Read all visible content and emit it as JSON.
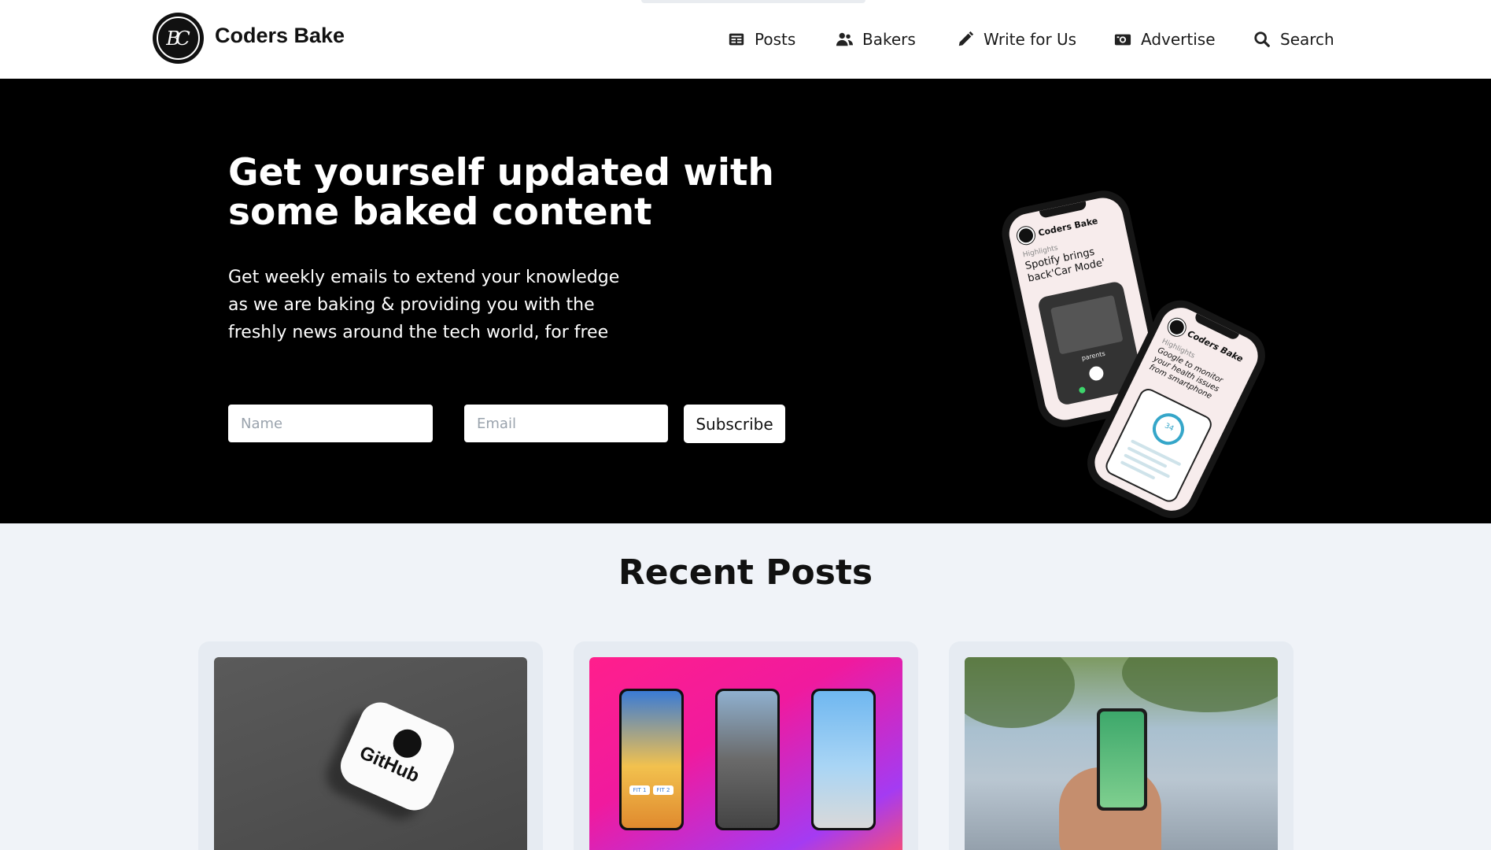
{
  "header": {
    "brand": "Coders Bake",
    "logo_glyph": "BC",
    "nav": [
      {
        "label": "Posts",
        "icon": "newspaper-icon"
      },
      {
        "label": "Bakers",
        "icon": "users-icon"
      },
      {
        "label": "Write for Us",
        "icon": "pencil-icon"
      },
      {
        "label": "Advertise",
        "icon": "ad-icon"
      },
      {
        "label": "Search",
        "icon": "search-icon"
      }
    ]
  },
  "hero": {
    "title": "Get yourself updated with some baked content",
    "text": "Get weekly emails to extend your knowledge as we are baking & providing you with the freshly news around the tech world, for free",
    "name_placeholder": "Name",
    "email_placeholder": "Email",
    "subscribe_label": "Subscribe",
    "phone1": {
      "brand": "Coders Bake",
      "section": "Highlights",
      "title": "Spotify brings back'Car Mode'",
      "track": "parents"
    },
    "phone2": {
      "brand": "Coders Bake",
      "section": "Highlights",
      "title": "Google to monitor your health issues from smartphone",
      "ring_value": "34"
    }
  },
  "recent": {
    "title": "Recent Posts",
    "cards": [
      {
        "image": "github-logo-cube",
        "badge": "GitHub"
      },
      {
        "image": "instagram-reels-phones",
        "reel_tags": [
          "FIT 1",
          "FIT 2"
        ]
      },
      {
        "image": "pokemon-go-phone-in-park"
      }
    ]
  },
  "colors": {
    "hero_bg": "#000000",
    "page_bg": "#f0f3f8",
    "card_bg": "#e6ebf2"
  }
}
